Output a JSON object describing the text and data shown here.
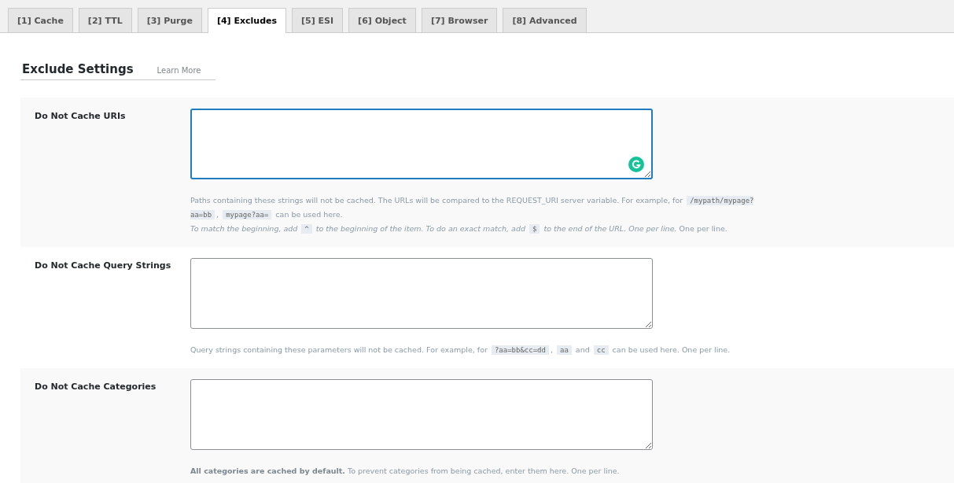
{
  "tabs": [
    {
      "label": "[1] Cache",
      "selected": false
    },
    {
      "label": "[2] TTL",
      "selected": false
    },
    {
      "label": "[3] Purge",
      "selected": false
    },
    {
      "label": "[4] Excludes",
      "selected": true
    },
    {
      "label": "[5] ESI",
      "selected": false
    },
    {
      "label": "[6] Object",
      "selected": false
    },
    {
      "label": "[7] Browser",
      "selected": false
    },
    {
      "label": "[8] Advanced",
      "selected": false
    }
  ],
  "section": {
    "title": "Exclude Settings",
    "link": "Learn More"
  },
  "settings": [
    {
      "label": "Do Not Cache URIs",
      "focused": true,
      "lines": [
        [
          {
            "kind": "text",
            "text": "Paths containing these strings will not be cached. The URLs will be compared to the REQUEST_URI server variable. For example, for "
          },
          {
            "kind": "code",
            "text": "/mypath/mypage?aa=bb"
          },
          {
            "kind": "text",
            "text": ", "
          },
          {
            "kind": "code",
            "text": "mypage?aa="
          },
          {
            "kind": "text",
            "text": " can be used here."
          }
        ],
        [
          {
            "kind": "italic",
            "text": "To match the beginning, add "
          },
          {
            "kind": "code",
            "text": "^"
          },
          {
            "kind": "italic",
            "text": " to the beginning of the item. To do an exact match, add "
          },
          {
            "kind": "code",
            "text": "$"
          },
          {
            "kind": "italic",
            "text": " to the end of the URL. One per line."
          },
          {
            "kind": "text",
            "text": " One per line."
          }
        ]
      ]
    },
    {
      "label": "Do Not Cache Query Strings",
      "focused": false,
      "lines": [
        [
          {
            "kind": "text",
            "text": "Query strings containing these parameters will not be cached. For example, for "
          },
          {
            "kind": "code",
            "text": "?aa=bb&cc=dd"
          },
          {
            "kind": "text",
            "text": ", "
          },
          {
            "kind": "code",
            "text": "aa"
          },
          {
            "kind": "text",
            "text": " and "
          },
          {
            "kind": "code",
            "text": "cc"
          },
          {
            "kind": "text",
            "text": " can be used here. One per line."
          }
        ]
      ]
    },
    {
      "label": "Do Not Cache Categories",
      "focused": false,
      "lines": [
        [
          {
            "kind": "bold",
            "text": "All categories are cached by default."
          },
          {
            "kind": "text",
            "text": " To prevent categories from being cached, enter them here. One per line."
          }
        ]
      ]
    }
  ]
}
